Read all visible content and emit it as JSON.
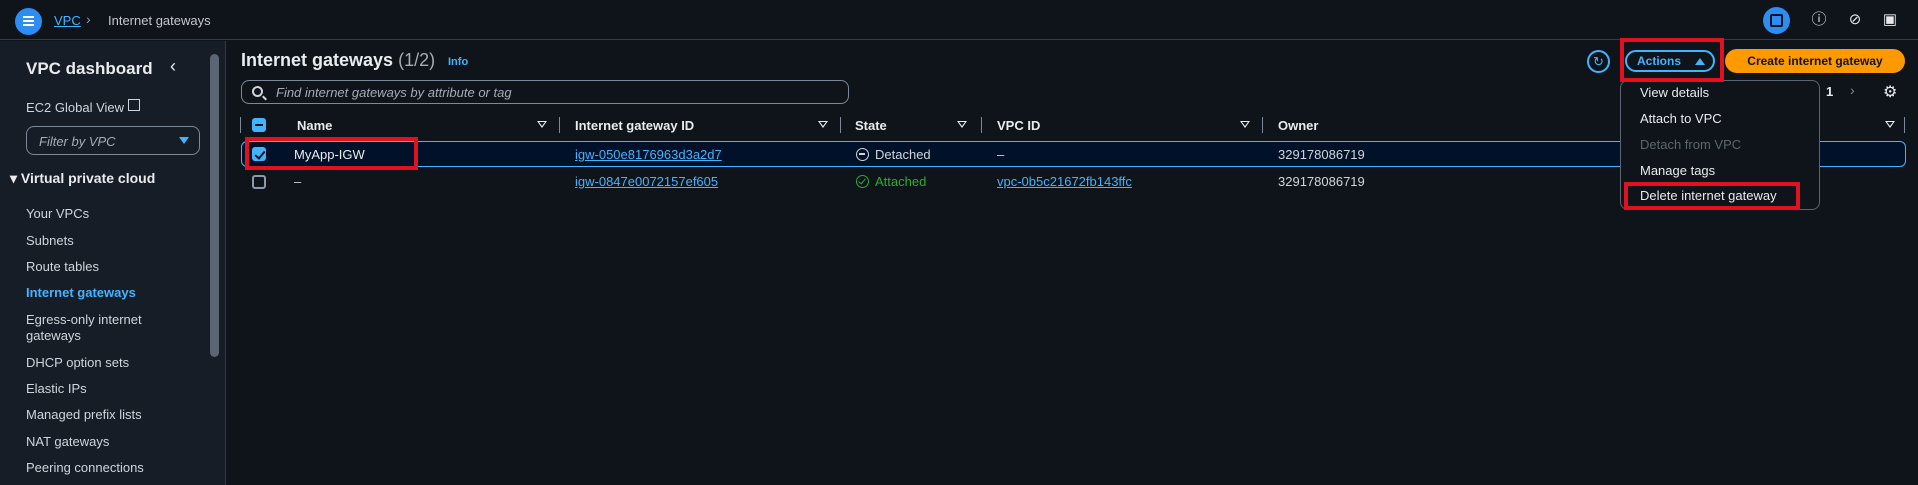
{
  "topbar": {
    "breadcrumb_root": "VPC",
    "breadcrumb_current": "Internet gateways"
  },
  "sidebar": {
    "title": "VPC dashboard",
    "ec2_global_view": "EC2 Global View",
    "filter_placeholder": "Filter by VPC",
    "section_title": "Virtual private cloud",
    "items": [
      {
        "label": "Your VPCs"
      },
      {
        "label": "Subnets"
      },
      {
        "label": "Route tables"
      },
      {
        "label": "Internet gateways"
      },
      {
        "label": "Egress-only internet"
      },
      {
        "label": "gateways"
      },
      {
        "label": "DHCP option sets"
      },
      {
        "label": "Elastic IPs"
      },
      {
        "label": "Managed prefix lists"
      },
      {
        "label": "NAT gateways"
      },
      {
        "label": "Peering connections"
      }
    ]
  },
  "main": {
    "title": "Internet gateways",
    "count": "(1/2)",
    "info": "Info",
    "search_placeholder": "Find internet gateways by attribute or tag",
    "actions_label": "Actions",
    "create_label": "Create internet gateway",
    "page_number": "1"
  },
  "table": {
    "columns": [
      "Name",
      "Internet gateway ID",
      "State",
      "VPC ID",
      "Owner"
    ],
    "rows": [
      {
        "name": "MyApp-IGW",
        "igw_id": "igw-050e8176963d3a2d7",
        "state": "Detached",
        "vpc_id": "–",
        "owner": "329178086719",
        "selected": true
      },
      {
        "name": "–",
        "igw_id": "igw-0847e0072157ef605",
        "state": "Attached",
        "vpc_id": "vpc-0b5c21672fb143ffc",
        "owner": "329178086719",
        "selected": false
      }
    ]
  },
  "actions_menu": {
    "items": [
      {
        "label": "View details",
        "disabled": false
      },
      {
        "label": "Attach to VPC",
        "disabled": false
      },
      {
        "label": "Detach from VPC",
        "disabled": true
      },
      {
        "label": "Manage tags",
        "disabled": false
      },
      {
        "label": "Delete internet gateway",
        "disabled": false
      }
    ]
  },
  "colors": {
    "accent": "#42b4ff",
    "primary_button": "#ff9900",
    "highlight": "#e0121f",
    "attached": "#29ad32"
  }
}
